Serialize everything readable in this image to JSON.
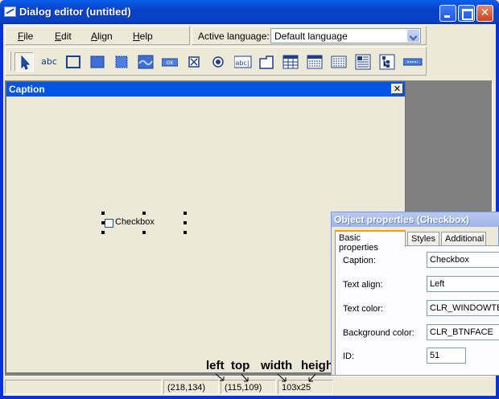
{
  "window": {
    "title": "Dialog editor (untitled)"
  },
  "menu": [
    {
      "label": "File",
      "accel": "F",
      "rest": "ile"
    },
    {
      "label": "Edit",
      "accel": "E",
      "rest": "dit"
    },
    {
      "label": "Align",
      "accel": "A",
      "rest": "lign"
    },
    {
      "label": "Help",
      "accel": "H",
      "rest": "elp"
    }
  ],
  "language": {
    "label": "Active language:",
    "value": "Default language"
  },
  "toolbar": {
    "tools": [
      "pointer-icon",
      "static-text-icon",
      "groupbox-icon",
      "filled-rect-icon",
      "frame-icon",
      "picture-icon",
      "button-icon",
      "checkbox-icon",
      "radio-icon",
      "edit-icon",
      "tabs-icon",
      "grid-icon",
      "listview-icon",
      "listbox-icon",
      "textarea-icon",
      "tree-icon",
      "progress-icon"
    ],
    "static_text_glyph": "abc",
    "button_glyph": "OK",
    "edit_glyph": "abc|"
  },
  "design_dialog": {
    "caption": "Caption",
    "close_glyph": "✕",
    "checkbox_label": "Checkbox"
  },
  "status": {
    "position": "(218,134)",
    "topleft": "(115,109)",
    "size": "103x25"
  },
  "annotations": {
    "left": "left",
    "top": "top",
    "width": "width",
    "height": "height"
  },
  "properties": {
    "title": "Object properties (Checkbox)",
    "tabs": [
      "Basic properties",
      "Styles",
      "Additional"
    ],
    "active_tab": "Basic properties",
    "rows": [
      {
        "label": "Caption:",
        "value": "Checkbox"
      },
      {
        "label": "Text align:",
        "value": "Left"
      },
      {
        "label": "Text color:",
        "value": "CLR_WINDOWTEXT"
      },
      {
        "label": "Background color:",
        "value": "CLR_BTNFACE"
      },
      {
        "label": "ID:",
        "value": "51"
      }
    ]
  },
  "colors": {
    "titlebar": "#0054e3",
    "face": "#ece9d8",
    "workspace": "#808080"
  }
}
